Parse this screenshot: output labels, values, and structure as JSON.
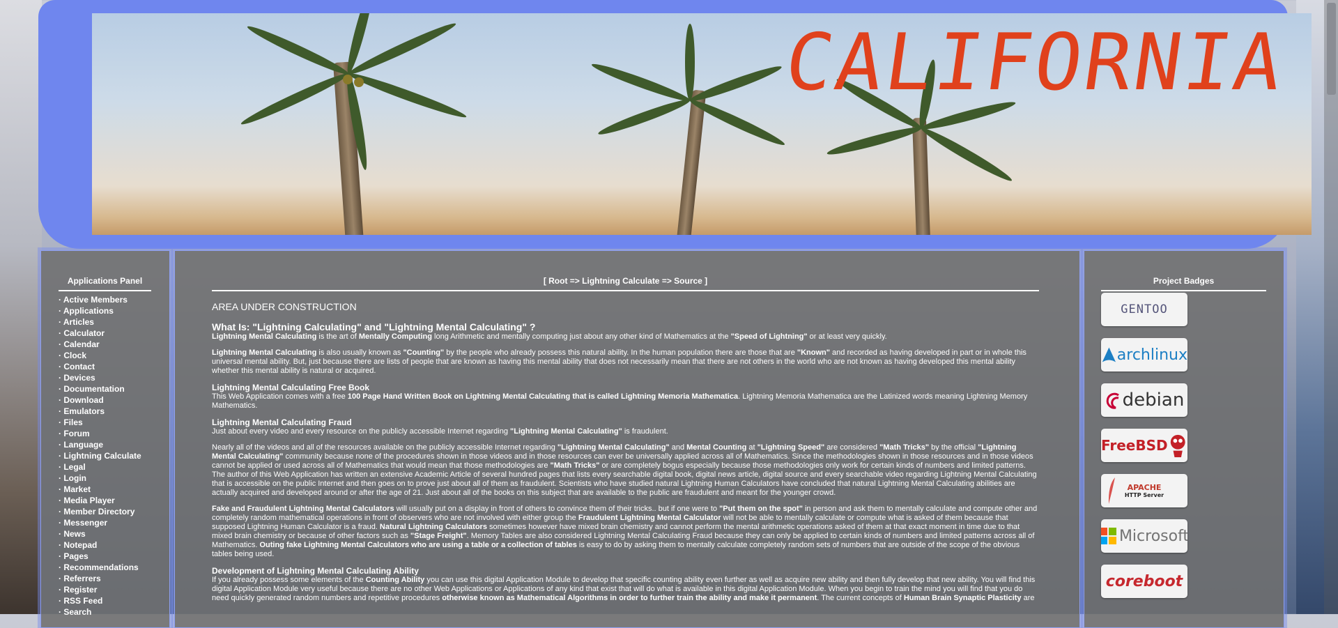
{
  "header": {
    "banner_title": "CALIFORNIA"
  },
  "apps_panel": {
    "title": "Applications Panel",
    "items": [
      "Active Members",
      "Applications",
      "Articles",
      "Calculator",
      "Calendar",
      "Clock",
      "Contact",
      "Devices",
      "Documentation",
      "Download",
      "Emulators",
      "Files",
      "Forum",
      "Language",
      "Lightning Calculate",
      "Legal",
      "Login",
      "Market",
      "Media Player",
      "Member Directory",
      "Messenger",
      "News",
      "Notepad",
      "Pages",
      "Recommendations",
      "Referrers",
      "Register",
      "RSS Feed",
      "Search"
    ]
  },
  "main": {
    "breadcrumb": "[ Root => Lightning Calculate => Source ]",
    "notice": "AREA UNDER CONSTRUCTION",
    "heading": "What Is: \"Lightning Calculating\" and \"Lightning Mental Calculating\" ?",
    "p1": {
      "b1": "Lightning Mental Calculating",
      "t1": " is the art of ",
      "b2": "Mentally Computing",
      "t2": " long Arithmetic and mentally computing just about any other kind of Mathematics at the ",
      "b3": "\"Speed of Lightning\"",
      "t3": " or at least very quickly."
    },
    "p2": {
      "b1": "Lightning Mental Calculating",
      "t1": " is also usually known as ",
      "b2": "\"Counting\"",
      "t2": " by the people who already possess this natural ability. In the human population there are those that are ",
      "b3": "\"Known\"",
      "t3": " and recorded as having developed in part or in whole this universal mental ability. But, just because there are lists of people that are known as having this mental ability that does not necessarily mean that there are not others in the world who are not known as having developed this mental ability whether this mental ability is natural or acquired."
    },
    "s1": {
      "heading": "Lightning Mental Calculating Free Book",
      "t1": "This Web Application comes with a free ",
      "b1": "100 Page Hand Written Book on Lightning Mental Calculating that is called Lightning Memoria Mathematica",
      "t2": ". Lightning Memoria Mathematica are the Latinized words meaning Lightning Memory Mathematics."
    },
    "s2": {
      "heading": "Lightning Mental Calculating Fraud",
      "t1": "Just about every video and every resource on the publicly accessible Internet regarding ",
      "b1": "\"Lightning Mental Calculating\"",
      "t2": " is fraudulent."
    },
    "p3": {
      "t1": "Nearly all of the videos and all of the resources available on the publicly accessible Internet regarding ",
      "b1": "\"Lightning Mental Calculating\"",
      "t2": " and ",
      "b2": "Mental Counting",
      "t3": " at ",
      "b3": "\"Lightning Speed\"",
      "t4": " are considered ",
      "b4": "\"Math Tricks\"",
      "t5": " by the official ",
      "b5": "\"Lightning Mental Calculating\"",
      "t6": " community because none of the procedures shown in those videos and in those resources can ever be universally applied across all of Mathematics. Since the methodologies shown in those resources and in those videos cannot be applied or used across all of Mathematics that would mean that those methodologies are ",
      "b6": "\"Math Tricks\"",
      "t7": " or are completely bogus especially because those methodologies only work for certain kinds of numbers and limited patterns. The author of this Web Application has written an extensive Academic Article of several hundred pages that lists every searchable digital book, digital news article, digital source and every searchable video regarding Lightning Mental Calculating that is accessible on the public Internet and then goes on to prove just about all of them as fraudulent. Scientists who have studied natural Lightning Human Calculators have concluded that natural Lightning Mental Calculating abilities are actually acquired and developed around or after the age of 21. Just about all of the books on this subject that are available to the public are fraudulent and meant for the younger crowd."
    },
    "p4": {
      "b1": "Fake and Fraudulent Lightning Mental Calculators",
      "t1": " will usually put on a display in front of others to convince them of their tricks.. but if one were to ",
      "b2": "\"Put them on the spot\"",
      "t2": " in person and ask them to mentally calculate and compute other and completely random mathematical operations in front of observers who are not involved with either group the ",
      "b3": "Fraudulent Lightning Mental Calculator",
      "t3": " will not be able to mentally calculate or compute what is asked of them because that supposed Lightning Human Calculator is a fraud. ",
      "b4": "Natural Lightning Calculators",
      "t4": " sometimes however have mixed brain chemistry and cannot perform the mental arithmetic operations asked of them at that exact moment in time due to that mixed brain chemistry or because of other factors such as ",
      "b5": "\"Stage Freight\"",
      "t5": ". Memory Tables are also considered Lightning Mental Calculating Fraud because they can only be applied to certain kinds of numbers and limited patterns across all of Mathematics. ",
      "b6": "Outing fake Lightning Mental Calculators who are using a table or a collection of tables",
      "t6": " is easy to do by asking them to mentally calculate completely random sets of numbers that are outside of the scope of the obvious tables being used."
    },
    "s3": {
      "heading": "Development of Lightning Mental Calculating Ability",
      "t1": "If you already possess some elements of the ",
      "b1": "Counting Ability",
      "t2": " you can use this digital Application Module to develop that specific counting ability even further as well as acquire new ability and then fully develop that new ability. You will find this digital Application Module very useful because there are no other Web Applications or Applications of any kind that exist that will do what is available in this digital Application Module. When you begin to train the mind you will find that you do need quickly generated random numbers and repetitive procedures ",
      "b2": "otherwise known as Mathematical Algorithms in order to further train the ability and make it permanent",
      "t3": ". The current concepts of ",
      "b3": "Human Brain Synaptic Plasticity",
      "t4": " are"
    }
  },
  "badges_panel": {
    "title": "Project Badges",
    "badges": [
      "GENTOO",
      "archlinux",
      "debian",
      "FreeBSD",
      "APACHE",
      "HTTP Server",
      "Microsoft",
      "coreboot"
    ]
  },
  "colors": {
    "frame": "#6f86ee",
    "panel": "#6e6e6e",
    "banner_title": "#e0411c"
  },
  "icons": [
    "gentoo-logo-icon",
    "archlinux-logo-icon",
    "debian-logo-icon",
    "freebsd-logo-icon",
    "apache-feather-icon",
    "microsoft-logo-icon",
    "coreboot-logo-icon"
  ]
}
